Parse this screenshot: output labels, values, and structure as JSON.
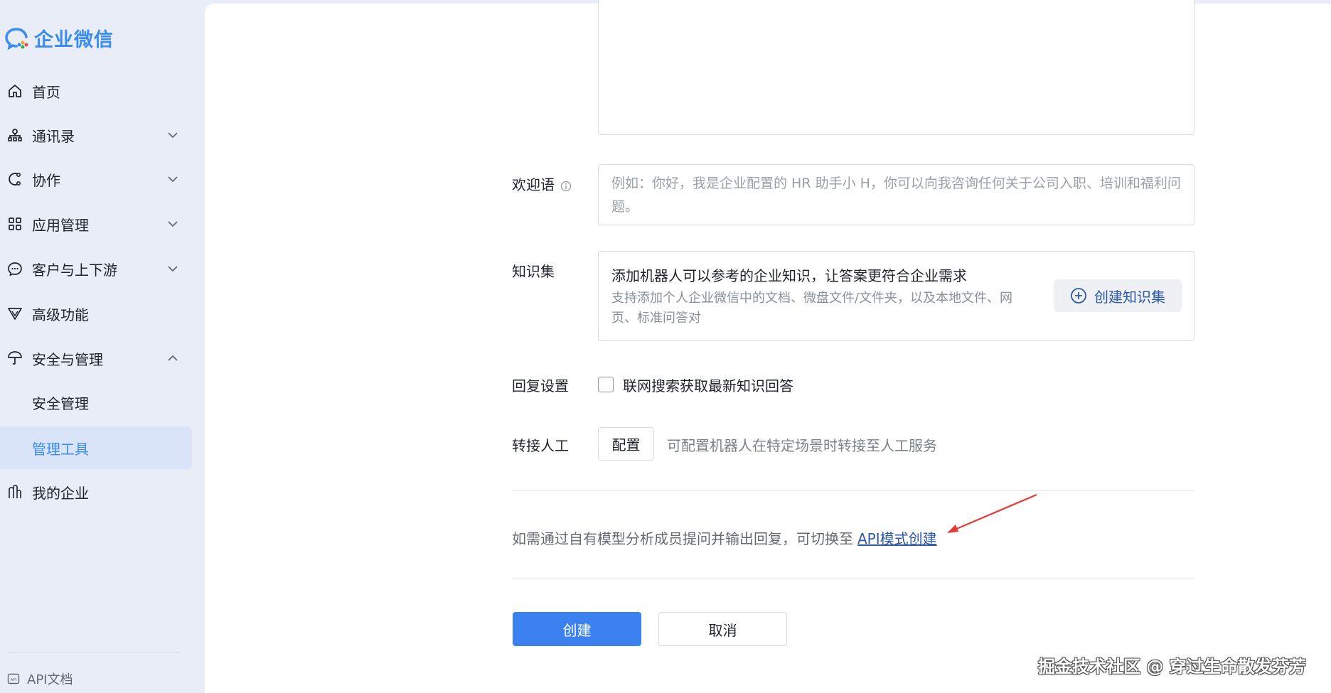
{
  "brand": {
    "name": "企业微信",
    "accent": "#3b8cf0"
  },
  "sidebar": {
    "items": [
      {
        "label": "首页",
        "icon": "home-icon"
      },
      {
        "label": "通讯录",
        "icon": "org-chart-icon"
      },
      {
        "label": "协作",
        "icon": "collaboration-icon"
      },
      {
        "label": "应用管理",
        "icon": "apps-grid-icon"
      },
      {
        "label": "客户与上下游",
        "icon": "chat-bubble-icon"
      },
      {
        "label": "高级功能",
        "icon": "advanced-icon"
      },
      {
        "label": "安全与管理",
        "icon": "umbrella-icon"
      },
      {
        "label": "安全管理"
      },
      {
        "label": "管理工具"
      },
      {
        "label": "我的企业",
        "icon": "building-icon"
      }
    ],
    "api_doc": "API文档"
  },
  "form": {
    "welcome_label": "欢迎语",
    "welcome_placeholder": "例如：你好，我是企业配置的 HR 助手小 H，你可以向我咨询任何关于公司入职、培训和福利问题。",
    "knowledge_label": "知识集",
    "knowledge_title": "添加机器人可以参考的企业知识，让答案更符合企业需求",
    "knowledge_desc": "支持添加个人企业微信中的文档、微盘文件/文件夹，以及本地文件、网页、标准问答对",
    "knowledge_button": "创建知识集",
    "reply_label": "回复设置",
    "reply_checkbox": "联网搜索获取最新知识回答",
    "reply_checked": false,
    "transfer_label": "转接人工",
    "transfer_button": "配置",
    "transfer_hint": "可配置机器人在特定场景时转接至人工服务",
    "api_switch_text": "如需通过自有模型分析成员提问并输出回复，可切换至",
    "api_switch_link": "API模式创建",
    "create_button": "创建",
    "cancel_button": "取消"
  },
  "watermark": "掘金技术社区 @ 穿过生命散发芬芳"
}
